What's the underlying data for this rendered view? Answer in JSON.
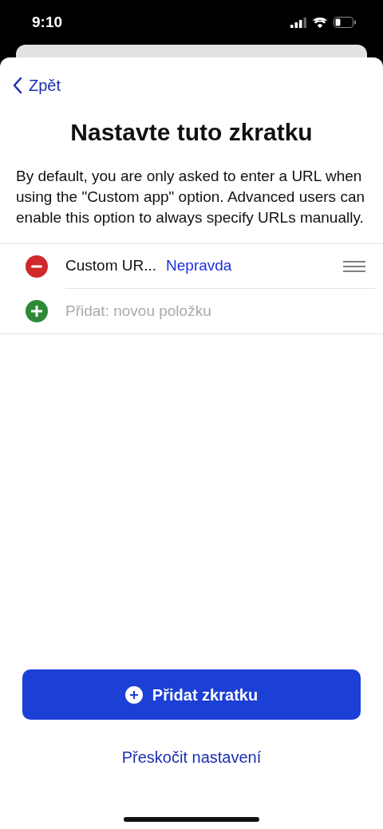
{
  "status_bar": {
    "time": "9:10"
  },
  "back": {
    "label": "Zpět"
  },
  "title": "Nastavte tuto zkratku",
  "description": "By default, you are only asked to enter a URL when using the \"Custom app\" option. Advanced users can enable this option to always specify URLs manually.",
  "items": [
    {
      "kind": "entry",
      "label": "Custom UR...",
      "value": "Nepravda"
    },
    {
      "kind": "add",
      "placeholder": "Přidat: novou položku"
    }
  ],
  "primary_button": {
    "label": "Přidat zkratku"
  },
  "skip_link": {
    "label": "Přeskočit nastavení"
  }
}
